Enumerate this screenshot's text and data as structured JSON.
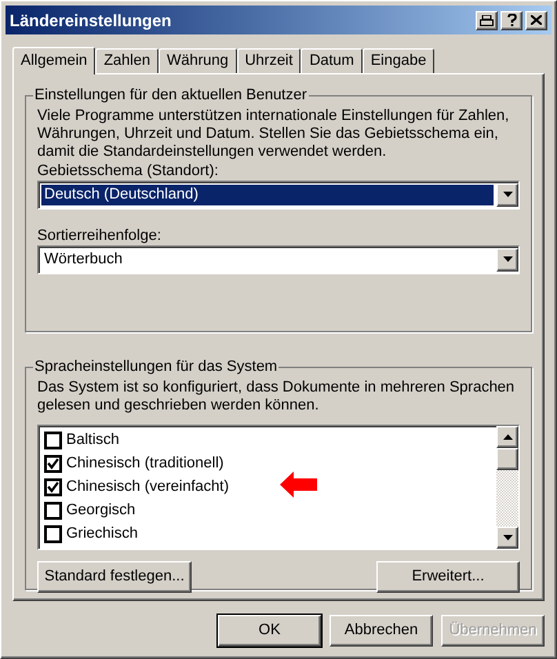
{
  "window": {
    "title": "Ländereinstellungen"
  },
  "tabs": [
    {
      "label": "Allgemein",
      "selected": true
    },
    {
      "label": "Zahlen",
      "selected": false
    },
    {
      "label": "Währung",
      "selected": false
    },
    {
      "label": "Uhrzeit",
      "selected": false
    },
    {
      "label": "Datum",
      "selected": false
    },
    {
      "label": "Eingabe",
      "selected": false
    }
  ],
  "user_group": {
    "title": "Einstellungen für den aktuellen Benutzer",
    "description": "Viele Programme unterstützen internationale Einstellungen für Zahlen, Währungen, Uhrzeit und Datum. Stellen Sie das Gebietsschema ein, damit die Standardeinstellungen verwendet werden.",
    "locale_label": "Gebietsschema (Standort):",
    "locale_value": "Deutsch (Deutschland)",
    "sort_label": "Sortierreihenfolge:",
    "sort_value": "Wörterbuch"
  },
  "system_group": {
    "title": "Spracheinstellungen für das System",
    "description": "Das System ist so konfiguriert, dass Dokumente in mehreren Sprachen gelesen und geschrieben werden können.",
    "languages": [
      {
        "label": "Baltisch",
        "checked": false
      },
      {
        "label": "Chinesisch (traditionell)",
        "checked": true
      },
      {
        "label": "Chinesisch (vereinfacht)",
        "checked": true
      },
      {
        "label": "Georgisch",
        "checked": false
      },
      {
        "label": "Griechisch",
        "checked": false
      }
    ],
    "buttons": [
      {
        "label": "Standard festlegen..."
      },
      {
        "label": "Erweitert..."
      }
    ]
  },
  "buttons": [
    {
      "label": "OK",
      "disabled": false,
      "default": true
    },
    {
      "label": "Abbrechen",
      "disabled": false,
      "default": false
    },
    {
      "label": "Übernehmen",
      "disabled": true,
      "default": false
    }
  ]
}
